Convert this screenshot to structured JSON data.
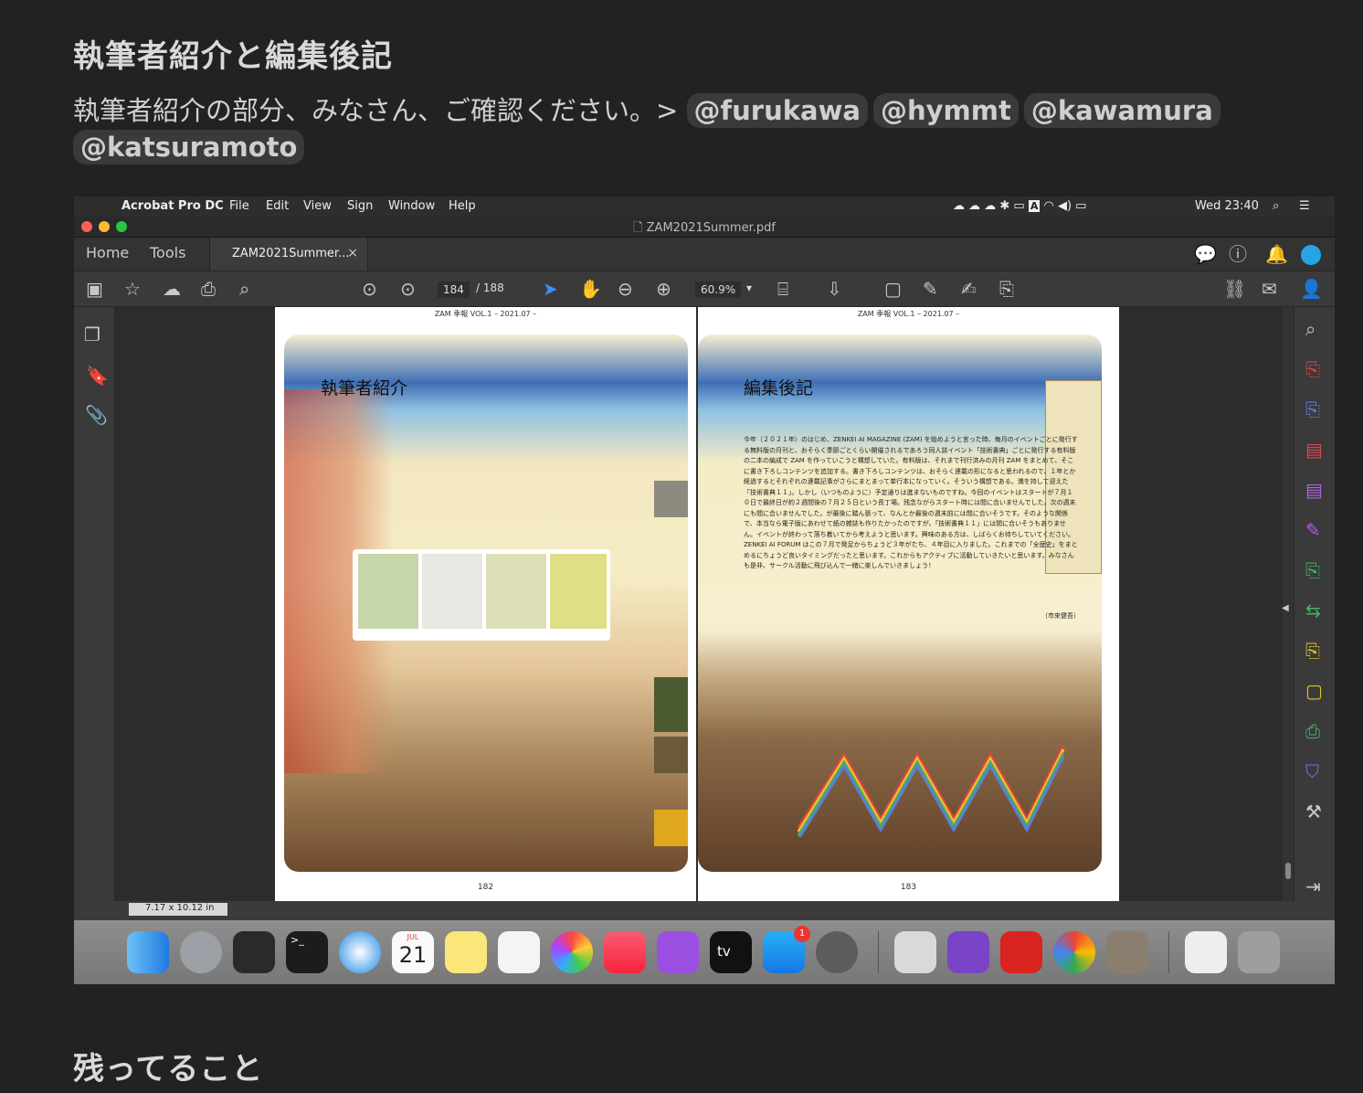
{
  "heading_intro": "執筆者紹介と編集後記",
  "message": {
    "text": "執筆者紹介の部分、みなさん、ご確認ください。>",
    "mentions": [
      "@furukawa",
      "@hymmt",
      "@kawamura",
      "@katsuramoto"
    ]
  },
  "heading_remaining": "残ってること",
  "screenshot": {
    "menubar": {
      "app": "Acrobat Pro DC",
      "items": [
        "File",
        "Edit",
        "View",
        "Sign",
        "Window",
        "Help"
      ],
      "clock": "Wed 23:40"
    },
    "window_title": "ZAM2021Summer.pdf",
    "tabs": {
      "home": "Home",
      "tools": "Tools",
      "file": "ZAM2021Summer...",
      "close": "×"
    },
    "toolbar": {
      "page_current": "184",
      "page_total": "/ 188",
      "zoom": "60.9%"
    },
    "pages": {
      "left": {
        "header": "ZAM 季報 VOL.1 – 2021.07 –",
        "title": "執筆者紹介",
        "number": "182"
      },
      "right": {
        "header": "ZAM 季報 VOL.1 – 2021.07 –",
        "title": "編集後記",
        "number": "183",
        "body": "今年（２０２１年）のはじめ、ZENKEI AI MAGAZINE (ZAM) を始めようと言った時、毎月のイベントごとに発行する無料版の月刊と、おそらく季節ごとくらい開催されるであろう同人誌イベント「技術書典」ごとに発行する有料版の二本の編成で ZAM を作っていこうと構想していた。有料版は、それまで刊行済みの月刊 ZAM をまとめて、そこに書き下ろしコンテンツを追加する。書き下ろしコンテンツは、おそらく連載の形になると思われるので、１年とか経過するとそれぞれの連載記事がさらにまとまって単行本になっていく。そういう構想である。満を持して迎えた「技術書典１１」。しかし（いつものように）予定通りは進まないものですね。今回のイベントはスタートが７月１０日で最終日が約２週間後の７月２５日という長丁場。残念ながらスタート時には間に合いませんでした。次の週末にも間に合いませんでした。が最後に踏ん張って、なんとか最後の週末前には間に合いそうです。そのような関係で、本当なら電子版にあわせて紙の雑誌も作りたかったのですが、「技術書典１１」には間に合いそうもありません。イベントが終わって落ち着いてから考えようと思います。興味のある方は、しばらくお待ちしていてください。ZENKEI AI FORUM はこの７月で発足からちょうど３年がたち、４年目に入りました。これまでの「全歴史」をまとめるにちょうど良いタイミングだったと思います。これからもアクティブに活動していきたいと思います。みなさんも是非、サークル活動に飛び込んで一緒に楽しんでいきましょう！",
        "signature": "（市來健吾）"
      }
    },
    "size_indicator": "7.17 x 10.12 in",
    "dock": {
      "calendar_month": "JUL",
      "calendar_day": "21",
      "appstore_badge": "1",
      "tv_label": "tv"
    }
  }
}
